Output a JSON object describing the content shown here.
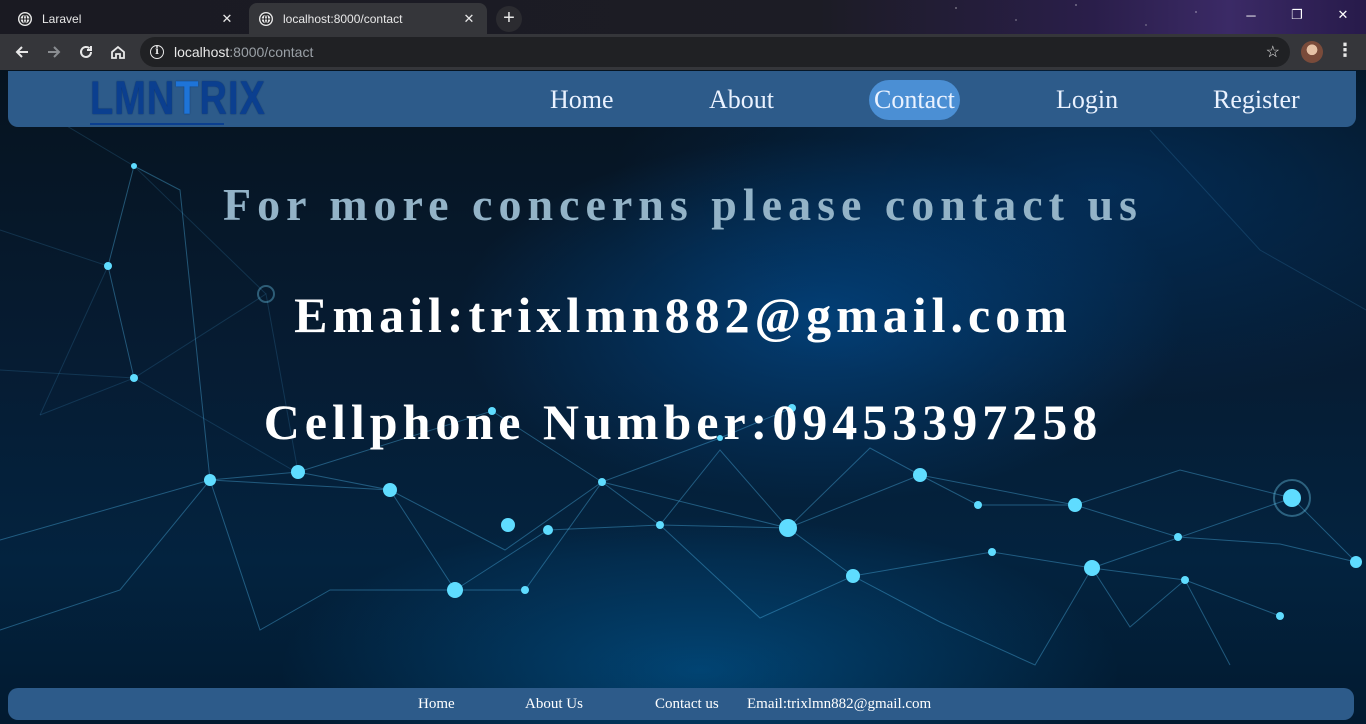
{
  "browser": {
    "tabs": [
      {
        "title": "Laravel",
        "active": false
      },
      {
        "title": "localhost:8000/contact",
        "active": true
      }
    ],
    "url_host": "localhost",
    "url_path": ":8000/contact",
    "icons": {
      "back": "arrow-left-icon",
      "forward": "arrow-right-icon",
      "reload": "reload-icon",
      "home": "home-icon",
      "info": "info-icon",
      "bookmark": "star-icon",
      "menu": "kebab-menu-icon"
    },
    "window_controls": {
      "minimize": "─",
      "restore": "❐",
      "close": "✕"
    }
  },
  "site": {
    "logo": {
      "prefix": "LMN",
      "highlight": "T",
      "suffix": "RIX"
    },
    "nav": [
      {
        "label": "Home",
        "active": false
      },
      {
        "label": "About",
        "active": false
      },
      {
        "label": "Contact",
        "active": true
      },
      {
        "label": "Login",
        "active": false
      },
      {
        "label": "Register",
        "active": false
      }
    ],
    "headline": "For more concerns please contact us",
    "email_line": "Email:trixlmn882@gmail.com",
    "phone_line": "Cellphone Number:09453397258",
    "footer": [
      {
        "label": "Home"
      },
      {
        "label": "About Us"
      },
      {
        "label": "Contact us"
      },
      {
        "label": "Email:trixlmn882@gmail.com"
      }
    ]
  },
  "colors": {
    "navbar_bg": "#2d5b8a",
    "nav_active_bg": "#4b8fd4",
    "headline": "#93b3c7",
    "text": "#ffffff",
    "logo_dark": "#0b3f8f",
    "logo_light": "#1e74d8"
  }
}
